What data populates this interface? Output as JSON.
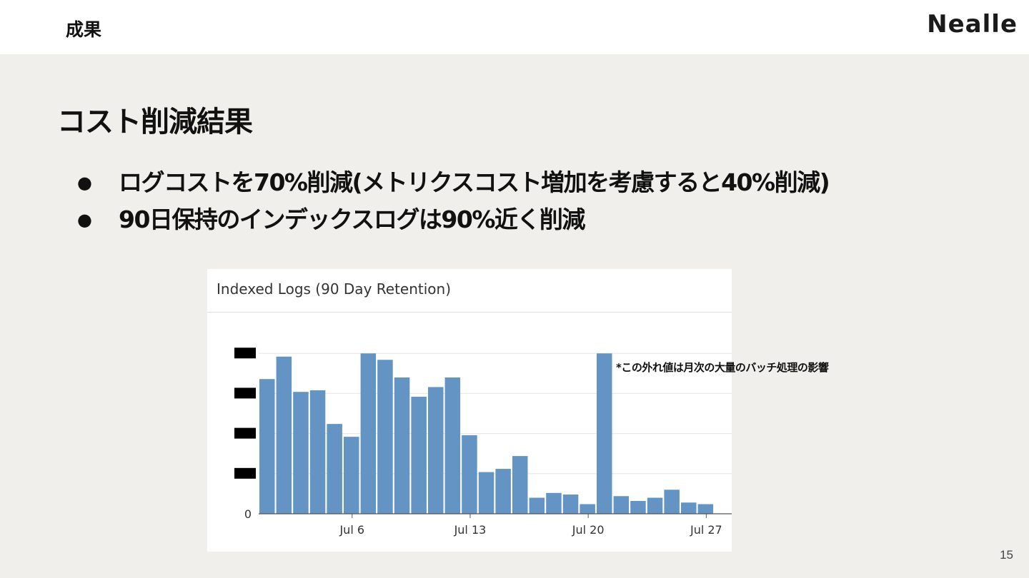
{
  "header": {
    "section": "成果",
    "logo": "Nealle"
  },
  "title": "コスト削減結果",
  "bullets": [
    "ログコストを70%削減(メトリクスコスト増加を考慮すると40%削減)",
    "90日保持のインデックスログは90%近く削減"
  ],
  "annotation": "*この外れ値は月次の大量のバッチ処理の影響",
  "page_number": "15",
  "colors": {
    "bar": "#6394c3",
    "redaction": "#000000",
    "background": "#f0efeb"
  },
  "chart_data": {
    "type": "bar",
    "title": "Indexed Logs (90 Day Retention)",
    "y_label_visible": "0",
    "y_tick_labels_redacted": true,
    "ylim": [
      0,
      101
    ],
    "grid": true,
    "x_tick_labels": [
      {
        "label": "Jul 6",
        "index": 5
      },
      {
        "label": "Jul 13",
        "index": 12
      },
      {
        "label": "Jul 20",
        "index": 19
      },
      {
        "label": "Jul 27",
        "index": 26
      }
    ],
    "values": [
      84,
      98,
      76,
      77,
      56,
      48,
      100,
      96,
      85,
      73,
      79,
      85,
      49,
      26,
      28,
      36,
      10,
      13,
      12,
      6,
      100,
      11,
      8,
      10,
      15,
      7,
      6
    ]
  }
}
